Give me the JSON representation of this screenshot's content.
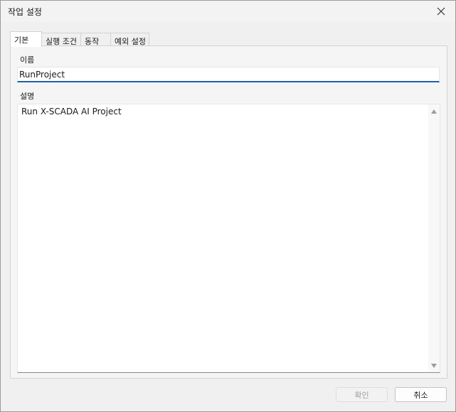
{
  "window": {
    "title": "작업 설정"
  },
  "tabs": [
    {
      "label": "기본",
      "active": true
    },
    {
      "label": "실행 조건",
      "active": false
    },
    {
      "label": "동작",
      "active": false
    },
    {
      "label": "예외 설정",
      "active": false
    }
  ],
  "form": {
    "name_label": "이름",
    "name_value": "RunProject",
    "description_label": "설명",
    "description_value": "Run X-SCADA AI Project"
  },
  "buttons": {
    "ok_label": "확인",
    "cancel_label": "취소"
  },
  "icons": {
    "close": "close-icon",
    "scroll_up": "arrow-up-icon",
    "scroll_down": "arrow-down-icon"
  },
  "colors": {
    "focus_underline": "#1f5fa8",
    "disabled_text": "#a0a0a0"
  }
}
